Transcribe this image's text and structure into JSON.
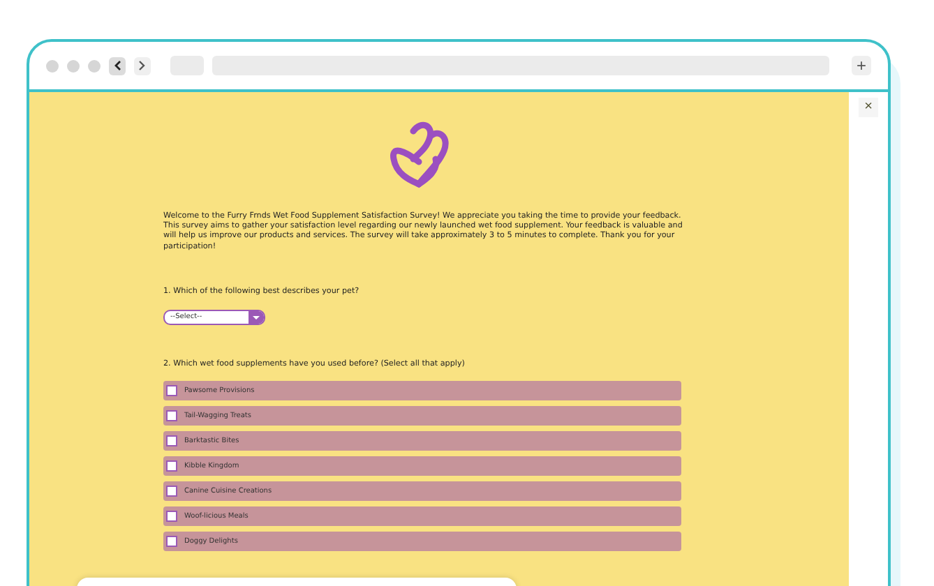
{
  "browser": {
    "close": "×",
    "new_tab": "+"
  },
  "survey": {
    "intro": "Welcome to the Furry Frnds Wet Food Supplement Satisfaction Survey! We appreciate you taking the time to provide your feedback. This survey aims to gather your satisfaction level regarding our newly launched wet food supplement. Your feedback is valuable and will help us improve our products and services. The survey will take approximately 3 to 5 minutes to complete. Thank you for your participation!",
    "questions": [
      {
        "kind": "select",
        "label": "1. Which of the following best describes your pet?",
        "placeholder": "--Select--"
      },
      {
        "kind": "checkboxes",
        "label": "2. Which wet food supplements have you used before? (Select all that apply)",
        "options": [
          {
            "label": "Pawsome Provisions",
            "checked": false
          },
          {
            "label": "Tail-Wagging Treats",
            "checked": false
          },
          {
            "label": "Barktastic Bites",
            "checked": false
          },
          {
            "label": "Kibble Kingdom",
            "checked": false
          },
          {
            "label": "Canine Cuisine Creations",
            "checked": false
          },
          {
            "label": "Woof-licious Meals",
            "checked": false
          },
          {
            "label": "Doggy Delights",
            "checked": false
          }
        ]
      }
    ]
  }
}
